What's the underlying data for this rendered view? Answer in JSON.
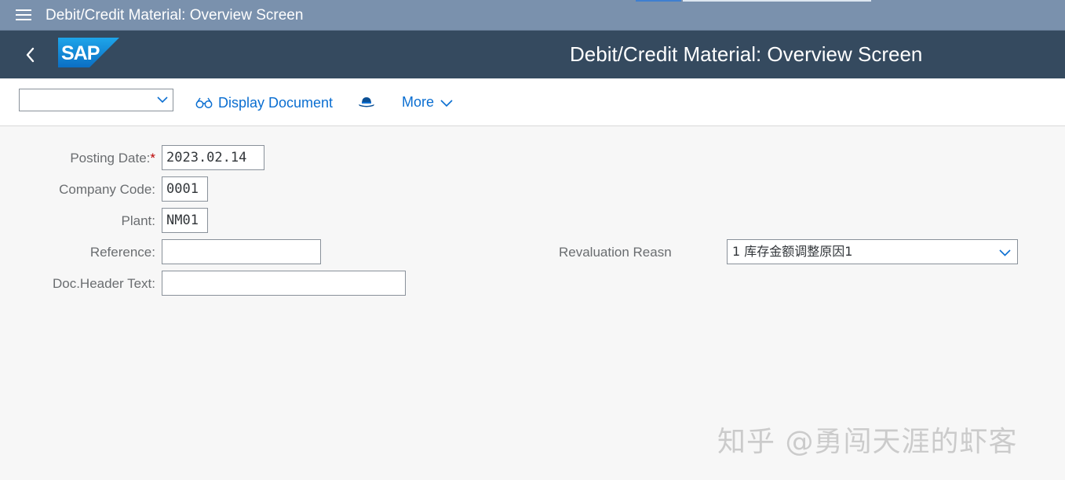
{
  "window": {
    "title": "Debit/Credit Material: Overview Screen"
  },
  "shell": {
    "logo_text": "SAP",
    "title": "Debit/Credit Material: Overview Screen"
  },
  "toolbar": {
    "variant_value": "",
    "display_document_label": "Display Document",
    "more_label": "More"
  },
  "form": {
    "posting_date": {
      "label": "Posting Date:",
      "required_mark": "*",
      "value": "2023.02.14"
    },
    "company_code": {
      "label": "Company Code:",
      "value": "0001"
    },
    "plant": {
      "label": "Plant:",
      "value": "NM01"
    },
    "reference": {
      "label": "Reference:",
      "value": ""
    },
    "doc_header_text": {
      "label": "Doc.Header Text:",
      "value": ""
    },
    "revaluation_reason": {
      "label": "Revaluation Reasn",
      "value": "1 库存金额调整原因1"
    }
  },
  "watermark": "知乎 @勇闯天涯的虾客",
  "colors": {
    "top_bar": "#7a91ad",
    "shell_bar": "#354a5f",
    "link_blue": "#0a6ed1",
    "required": "#bb0000",
    "background": "#f7f7f7"
  },
  "icons": {
    "menu": "hamburger-menu-icon",
    "back": "chevron-left-icon",
    "display_document": "glasses-icon",
    "hat": "hat-icon",
    "dropdown": "chevron-down-icon"
  }
}
